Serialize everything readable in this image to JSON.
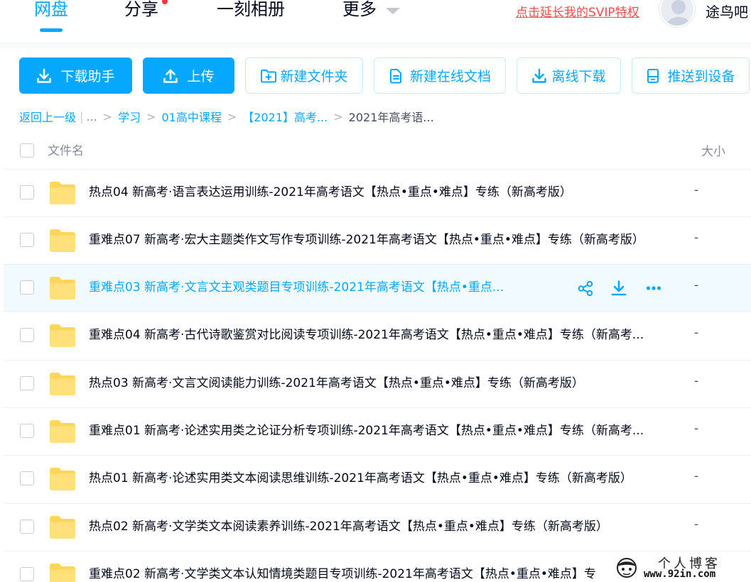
{
  "nav": {
    "tabs": [
      "网盘",
      "分享",
      "一刻相册",
      "更多"
    ],
    "svip_link": "点击延长我的SVIP特权",
    "username": "途鸟吧"
  },
  "toolbar": {
    "download_helper": "下载助手",
    "upload": "上传",
    "new_folder": "新建文件夹",
    "new_online_doc": "新建在线文档",
    "offline_download": "离线下载",
    "push_to_device": "推送到设备"
  },
  "breadcrumb": {
    "back": "返回上一级",
    "ellipsis": "...",
    "items": [
      "学习",
      "01高中课程",
      "【2021】高考..."
    ],
    "current": "2021年高考语..."
  },
  "list": {
    "col_name": "文件名",
    "col_size": "大小",
    "rows": [
      {
        "name": "热点04 新高考·语言表达运用训练-2021年高考语文【热点•重点•难点】专练（新高考版）",
        "size": "-"
      },
      {
        "name": "重难点07 新高考·宏大主题类作文写作专项训练-2021年高考语文【热点•重点•难点】专练（新高考版）",
        "size": "-"
      },
      {
        "name": "重难点03 新高考·文言文主观类题目专项训练-2021年高考语文【热点•重点...",
        "size": "-"
      },
      {
        "name": "重难点04 新高考·古代诗歌鉴赏对比阅读专项训练-2021年高考语文【热点•重点•难点】专练（新高考...",
        "size": "-"
      },
      {
        "name": "热点03 新高考·文言文阅读能力训练-2021年高考语文【热点•重点•难点】专练（新高考版）",
        "size": "-"
      },
      {
        "name": "重难点01 新高考·论述实用类之论证分析专项训练-2021年高考语文【热点•重点•难点】专练（新高考...",
        "size": "-"
      },
      {
        "name": "热点01 新高考·论述实用类文本阅读思维训练-2021年高考语文【热点•重点•难点】专练（新高考版）",
        "size": "-"
      },
      {
        "name": "热点02 新高考·文学类文本阅读素养训练-2021年高考语文【热点•重点•难点】专练（新高考版）",
        "size": "-"
      },
      {
        "name": "重难点02 新高考·文学类文本认知情境类题目专项训练-2021年高考语文【热点•重点•难点】专",
        "size": ""
      }
    ]
  },
  "watermark": {
    "title": "个人博客",
    "url": "www.92in.com"
  },
  "colors": {
    "accent": "#06a7ff",
    "folder": "#ffd659",
    "svip": "#f24c4c",
    "text": "#03081a"
  }
}
